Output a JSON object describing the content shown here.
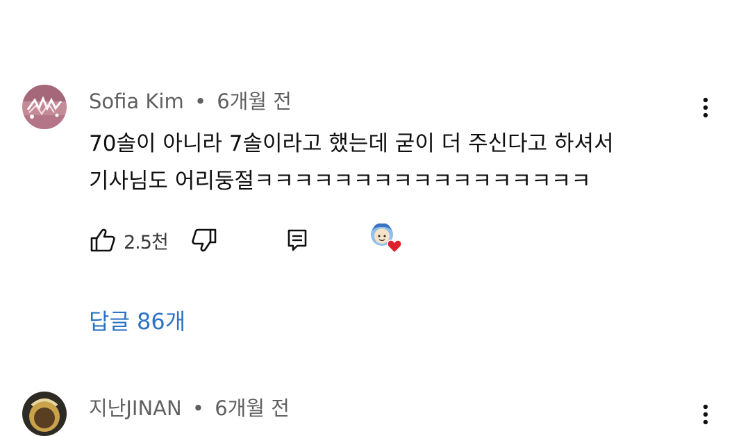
{
  "comments": [
    {
      "author": "Sofia Kim",
      "separator": "•",
      "time": "6개월 전",
      "text_lines": [
        "70솔이 아니라 7솔이라고 했는데 굳이 더 주신다고 하셔서",
        "기사님도 어리둥절ㅋㅋㅋㅋㅋㅋㅋㅋㅋㅋㅋㅋㅋㅋㅋㅋㅋ"
      ],
      "like_count": "2.5천",
      "replies_label": "답글 86개"
    },
    {
      "author": "지난JINAN",
      "separator": "•",
      "time": "6개월 전"
    }
  ],
  "icons": {
    "like": "thumbs-up-icon",
    "dislike": "thumbs-down-icon",
    "reply": "reply-icon",
    "more": "more-vert-icon",
    "creator_heart": "creator-heart-icon"
  },
  "colors": {
    "link": "#2e72c4",
    "meta": "#606060",
    "heart": "#e0202a"
  }
}
